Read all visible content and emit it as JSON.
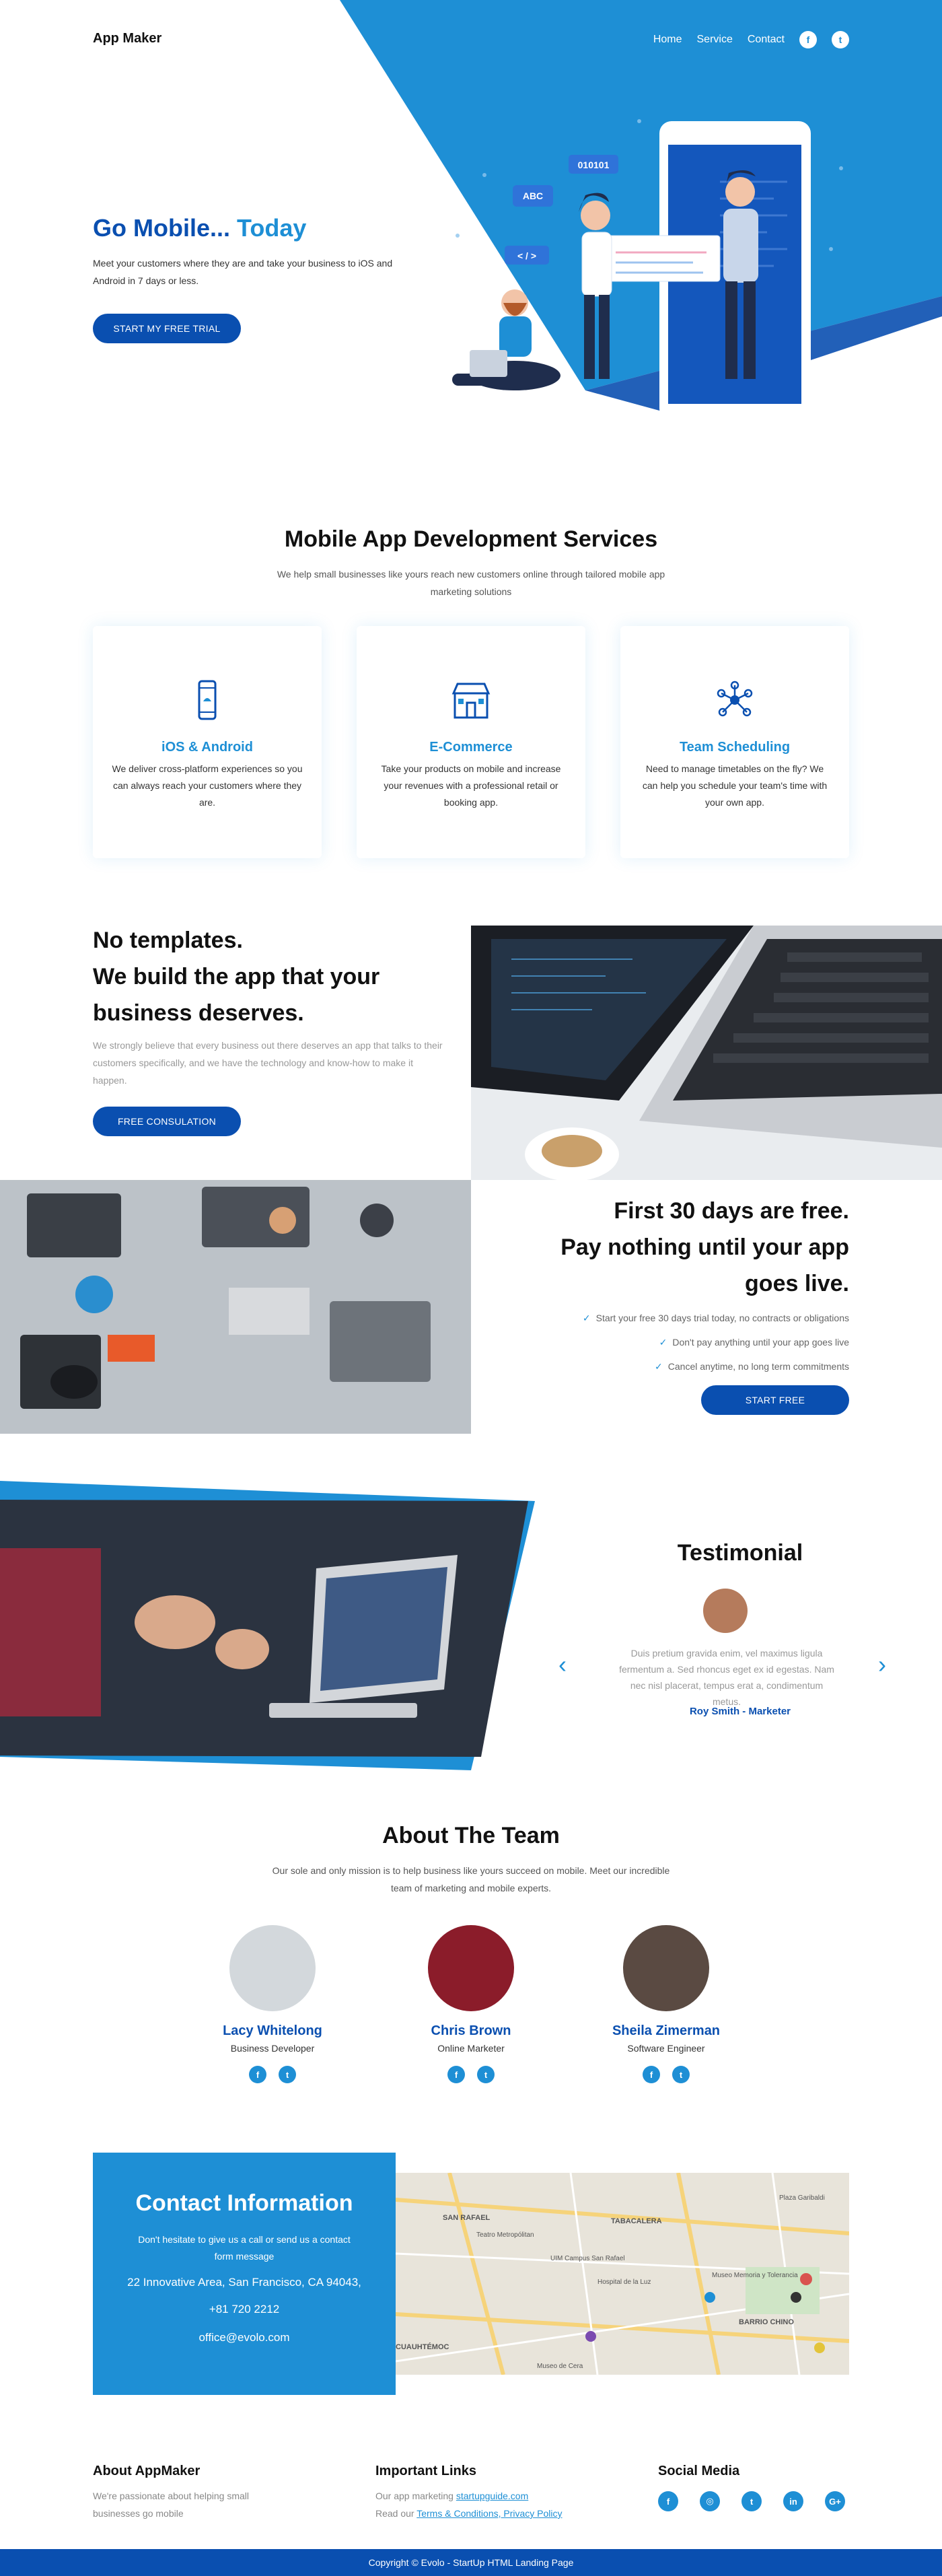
{
  "colors": {
    "primary": "#0a4fb0",
    "accent": "#1e8fd5",
    "text": "#333333"
  },
  "nav": {
    "logo": "App Maker",
    "links": [
      "Home",
      "Service",
      "Contact"
    ],
    "icons": [
      "facebook-icon",
      "twitter-icon"
    ]
  },
  "hero": {
    "title_part1": "Go Mobile...",
    "title_part2": "Today",
    "text": "Meet your customers where they are and take your business to iOS and Android in 7 days or less.",
    "button": "START MY FREE TRIAL",
    "illustration_labels": [
      "010101",
      "ABC",
      "< / >"
    ]
  },
  "services": {
    "title": "Mobile App Development Services",
    "subtitle": "We help small businesses like yours reach new customers online through tailored mobile app marketing solutions",
    "cards": [
      {
        "icon": "smartphone-icon",
        "title": "iOS & Android",
        "text": "We deliver cross-platform experiences so you can always reach your customers where they are."
      },
      {
        "icon": "store-icon",
        "title": "E-Commerce",
        "text": "Take your products on mobile and increase your revenues with a professional retail or booking app."
      },
      {
        "icon": "network-icon",
        "title": "Team Scheduling",
        "text": "Need to manage timetables on the fly? We can help you schedule your team's time with your own app."
      }
    ]
  },
  "templates": {
    "title_lines": [
      "No templates.",
      "We build the app that your",
      "business deserves."
    ],
    "text": "We strongly believe that every business out there deserves an app that talks to their customers specifically, and we have the technology and know-how to make it happen.",
    "button": "FREE CONSULATION"
  },
  "free": {
    "title_lines": [
      "First 30 days are free.",
      "Pay nothing until your app",
      "goes live."
    ],
    "checks": [
      "Start your free 30 days trial today, no contracts or obligations",
      "Don't pay anything until your app goes live",
      "Cancel anytime, no long term commitments"
    ],
    "button": "START FREE"
  },
  "testimonial": {
    "title": "Testimonial",
    "quote": "Duis pretium gravida enim, vel maximus ligula fermentum a. Sed rhoncus eget ex id egestas. Nam nec nisl placerat, tempus erat a, condimentum metus.",
    "author": "Roy Smith - Marketer"
  },
  "team": {
    "title": "About The Team",
    "subtitle": "Our sole and only mission is to help business like yours succeed on mobile. Meet our incredible team of marketing and mobile experts.",
    "members": [
      {
        "name": "Lacy Whitelong",
        "role": "Business Developer"
      },
      {
        "name": "Chris Brown",
        "role": "Online Marketer"
      },
      {
        "name": "Sheila Zimerman",
        "role": "Software Engineer"
      }
    ]
  },
  "contact": {
    "title": "Contact Information",
    "text": "Don't hesitate to give us a call or send us a contact form message",
    "address": "22 Innovative Area, San Francisco, CA 94043,",
    "phone": "+81 720 2212",
    "email": "office@evolo.com",
    "map_labels": [
      "Plaza Garibaldi",
      "SAN RAFAEL",
      "Teatro Metropólitan",
      "UIM Campus San Rafael",
      "TABACALERA",
      "Hospital de la Luz",
      "Museo Memoria y Tolerancia",
      "BARRIO CHINO",
      "Museo de Cera",
      "CUAUHTÉMOC"
    ]
  },
  "footer": {
    "about_title": "About AppMaker",
    "about_text": "We're passionate about helping small businesses go mobile",
    "links_title": "Important Links",
    "links_line1_prefix": "Our app marketing",
    "links_line1_link": "startupguide.com",
    "links_line2_prefix": "Read our",
    "links_line2_link": "Terms & Conditions, Privacy Policy",
    "social_title": "Social Media",
    "social_icons": [
      "facebook-icon",
      "instagram-icon",
      "twitter-icon",
      "linkedin-icon",
      "google-plus-icon"
    ],
    "copyright": "Copyright © Evolo - StartUp HTML Landing Page"
  }
}
